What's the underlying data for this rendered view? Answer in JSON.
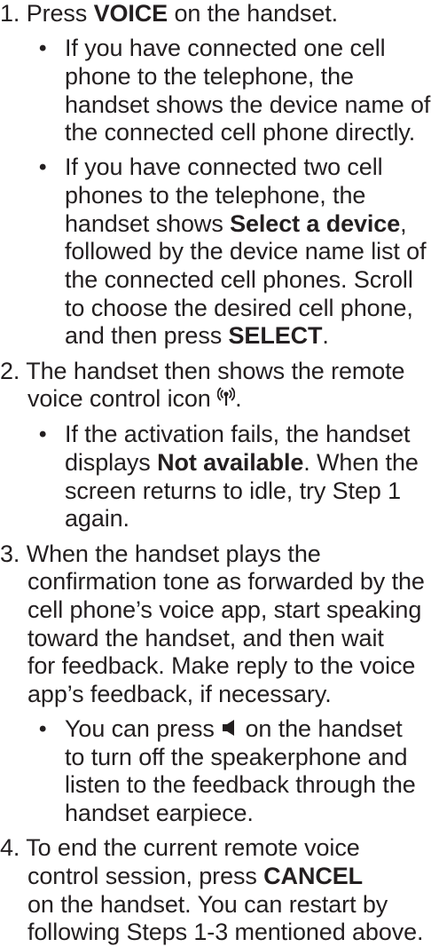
{
  "step1": {
    "num": "1.",
    "pre": "Press ",
    "key": "VOICE",
    "post": " on the handset.",
    "bullet1": [
      "If you have connected one cell",
      "phone to the telephone, the",
      "handset shows the device name of",
      "the connected cell phone directly."
    ],
    "bullet2": {
      "l1": "If you have connected two cell",
      "l2": "phones to the telephone, the",
      "l3_pre": "handset shows ",
      "l3_bold": "Select a device",
      "l3_post": ",",
      "l4": "followed by the device name list of",
      "l5": "the connected cell phones. Scroll",
      "l6": "to choose the desired cell phone,",
      "l7_pre": "and then press ",
      "l7_bold": "SELECT",
      "l7_post": "."
    }
  },
  "step2": {
    "num": "2.",
    "l1": "The handset then shows the remote",
    "l2_pre": "voice control icon ",
    "l2_post": ".",
    "bullet1": {
      "l1": "If the activation fails, the handset",
      "l2_pre": "displays ",
      "l2_bold": "Not available",
      "l2_post": ". When the",
      "l3": "screen returns to idle, try Step 1",
      "l4": "again."
    }
  },
  "step3": {
    "num": "3.",
    "lines": [
      "When the handset plays the",
      "confirmation tone as forwarded by the",
      "cell phone’s voice app, start speaking",
      "toward the handset, and then wait",
      "for feedback. Make reply to the voice",
      "app’s feedback, if necessary."
    ],
    "bullet1": {
      "l1_pre": "You can press ",
      "l1_post": " on the handset",
      "l2": "to turn off the speakerphone and",
      "l3": "listen to the feedback through the",
      "l4": "handset earpiece."
    }
  },
  "step4": {
    "num": "4.",
    "l1": "To end the current remote voice",
    "l2_pre": "control session, press ",
    "l2_bold": "CANCEL",
    "l3": "on the handset. You can restart by",
    "l4": "following Steps 1-3 mentioned above."
  },
  "icons": {
    "remote_voice": "remote-voice-control-icon",
    "speaker": "speakerphone-icon"
  },
  "colors": {
    "text": "#231f20"
  }
}
